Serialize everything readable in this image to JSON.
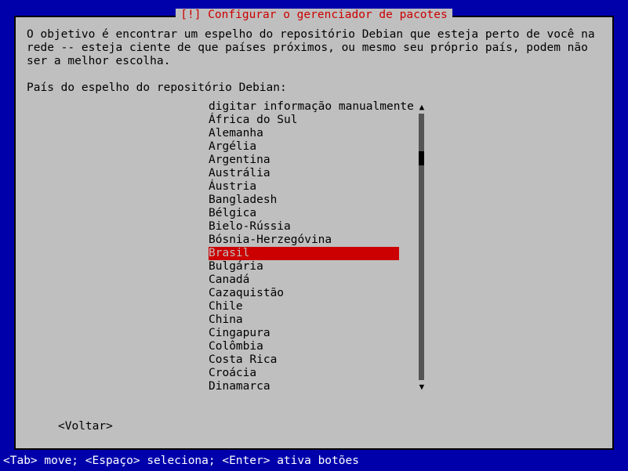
{
  "dialog": {
    "title": "[!] Configurar o gerenciador de pacotes",
    "description": "O objetivo é encontrar um espelho do repositório Debian que esteja perto de você na rede -- esteja ciente de que países próximos, ou mesmo seu próprio país, podem não ser a melhor escolha.",
    "prompt": "País do espelho do repositório Debian:",
    "items": [
      "digitar informação manualmente",
      "África do Sul",
      "Alemanha",
      "Argélia",
      "Argentina",
      "Austrália",
      "Áustria",
      "Bangladesh",
      "Bélgica",
      "Bielo-Rússia",
      "Bósnia-Herzegóvina",
      "Brasil",
      "Bulgária",
      "Canadá",
      "Cazaquistão",
      "Chile",
      "China",
      "Cingapura",
      "Colômbia",
      "Costa Rica",
      "Croácia",
      "Dinamarca"
    ],
    "selected_index": 11,
    "back_label": "<Voltar>"
  },
  "helpbar": "<Tab> move; <Espaço> seleciona; <Enter> ativa botões"
}
